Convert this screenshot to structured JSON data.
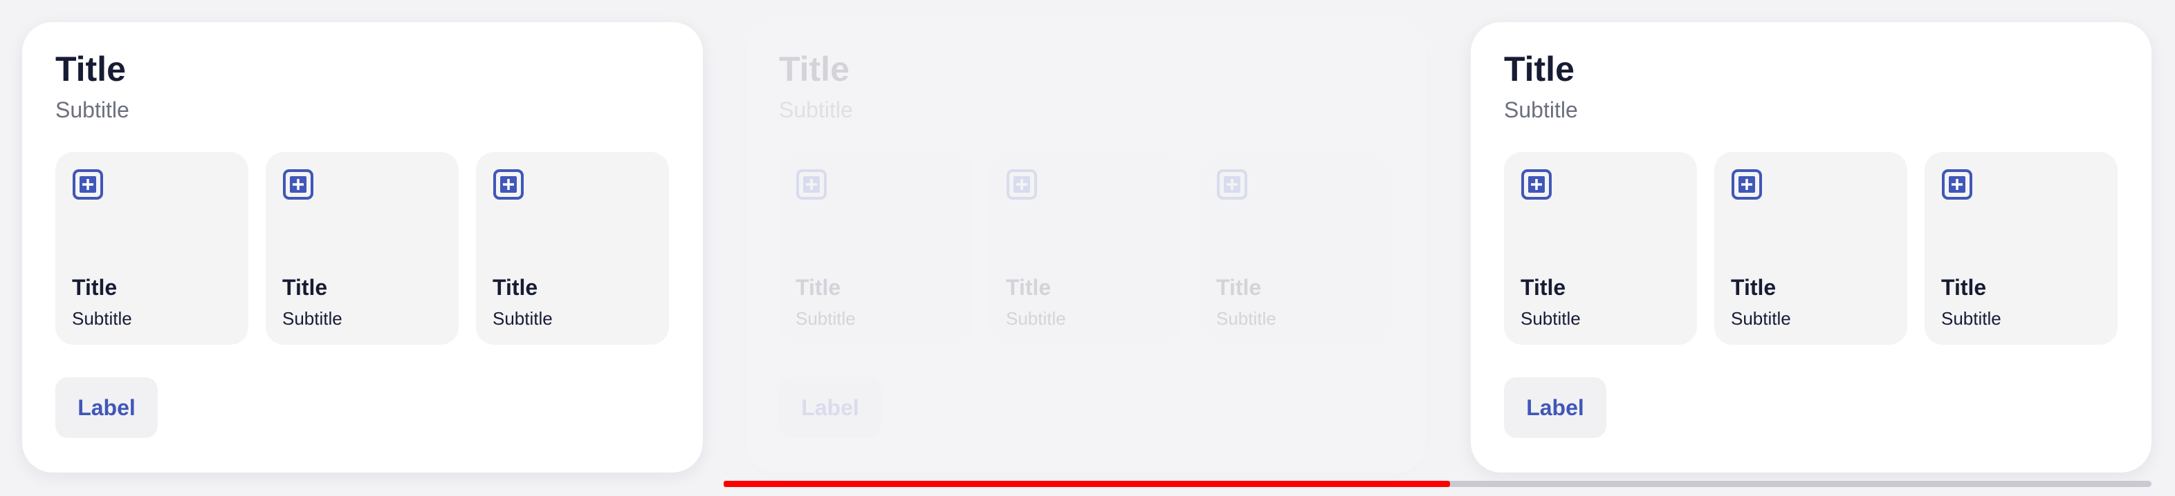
{
  "cards": [
    {
      "title": "Title",
      "subtitle": "Subtitle",
      "tiles": [
        {
          "title": "Title",
          "subtitle": "Subtitle",
          "icon": "plus-square-icon"
        },
        {
          "title": "Title",
          "subtitle": "Subtitle",
          "icon": "plus-square-icon"
        },
        {
          "title": "Title",
          "subtitle": "Subtitle",
          "icon": "plus-square-icon"
        }
      ],
      "button_label": "Label"
    },
    {
      "title": "Title",
      "subtitle": "Subtitle",
      "tiles": [
        {
          "title": "Title",
          "subtitle": "Subtitle",
          "icon": "plus-square-icon"
        },
        {
          "title": "Title",
          "subtitle": "Subtitle",
          "icon": "plus-square-icon"
        },
        {
          "title": "Title",
          "subtitle": "Subtitle",
          "icon": "plus-square-icon"
        }
      ],
      "button_label": "Label"
    },
    {
      "title": "Title",
      "subtitle": "Subtitle",
      "tiles": [
        {
          "title": "Title",
          "subtitle": "Subtitle",
          "icon": "plus-square-icon"
        },
        {
          "title": "Title",
          "subtitle": "Subtitle",
          "icon": "plus-square-icon"
        },
        {
          "title": "Title",
          "subtitle": "Subtitle",
          "icon": "plus-square-icon"
        }
      ],
      "button_label": "Label"
    }
  ],
  "colors": {
    "accent": "#4057b8",
    "text_primary": "#171c34",
    "text_secondary": "#6c6f7e",
    "tile_background": "#f4f4f5",
    "scroll_indicator": "#ff0000"
  }
}
